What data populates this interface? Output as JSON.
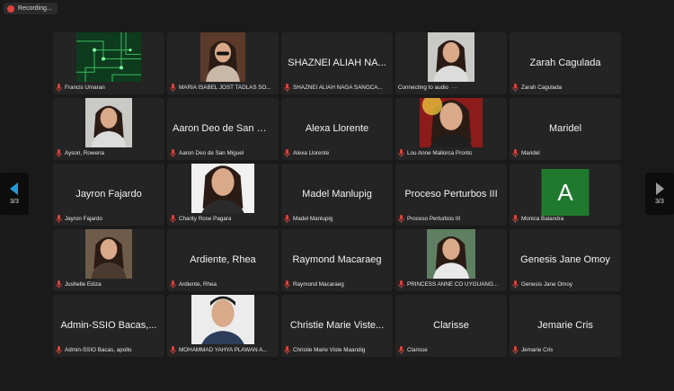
{
  "recording": {
    "label": "Recording..."
  },
  "pagination": {
    "left_label": "3/3",
    "right_label": "3/3"
  },
  "colors": {
    "background": "#1a1a1a",
    "tile": "#242424",
    "mic_muted": "#e0413b",
    "nav_active": "#1e9bd7",
    "nav_inactive": "#9a9a9a",
    "avatar": "#1f7a2e"
  },
  "participants": [
    {
      "display": "",
      "label": "Francis Umaran",
      "video": "circuit"
    },
    {
      "display": "",
      "label": "MARIA ISABEL JOST TADLAS SO...",
      "video": "woman-sunglasses"
    },
    {
      "display": "SHAZNEI ALIAH  NA...",
      "label": "SHAZNEI ALIAH  NAGA SANGCA..."
    },
    {
      "display": "",
      "label": "Connecting to audio",
      "video": "woman-smile",
      "connecting": true
    },
    {
      "display": "Zarah Cagulada",
      "label": "Zarah Cagulada"
    },
    {
      "display": "",
      "label": "Ayson, Rowena",
      "video": "woman-smile"
    },
    {
      "display": "Aaron Deo de San Mi...",
      "label": "Aaron Deo de San Miguel"
    },
    {
      "display": "Alexa Llorente",
      "label": "Alexa Llorente"
    },
    {
      "display": "",
      "label": "Lou Anne Mallorca Pronto",
      "video": "woman-flag"
    },
    {
      "display": "Maridel",
      "label": "Maridel"
    },
    {
      "display": "Jayron Fajardo",
      "label": "Jayron Fajardo"
    },
    {
      "display": "",
      "label": "Charity Rose Pagara",
      "video": "woman-portrait"
    },
    {
      "display": "Madel Manlupig",
      "label": "Madel Manlupig"
    },
    {
      "display": "Proceso Perturbos III",
      "label": "Proceso Perturbos III"
    },
    {
      "display": "",
      "label": "Monica Balandra",
      "avatar": "A"
    },
    {
      "display": "",
      "label": "Jushelle Ediza",
      "video": "woman-casual"
    },
    {
      "display": "Ardiente, Rhea",
      "label": "Ardiente, Rhea"
    },
    {
      "display": "Raymond Macaraeg",
      "label": "Raymond Macaraeg"
    },
    {
      "display": "",
      "label": "PRINCESS ANNE CO UYGUANG...",
      "video": "woman-outdoor"
    },
    {
      "display": "Genesis Jane Omoy",
      "label": "Genesis Jane Omoy"
    },
    {
      "display": "Admin-SSIO Bacas,...",
      "label": "Admin-SSIO Bacas, apollo"
    },
    {
      "display": "",
      "label": "MOHAMMAD YAHYA PLAWAN A...",
      "video": "man-portrait"
    },
    {
      "display": "Christie Marie Viste...",
      "label": "Christie Marie Viste Maandig"
    },
    {
      "display": "Clarisse",
      "label": "Clarisse"
    },
    {
      "display": "Jemarie Cris",
      "label": "Jemarie Cris"
    }
  ]
}
